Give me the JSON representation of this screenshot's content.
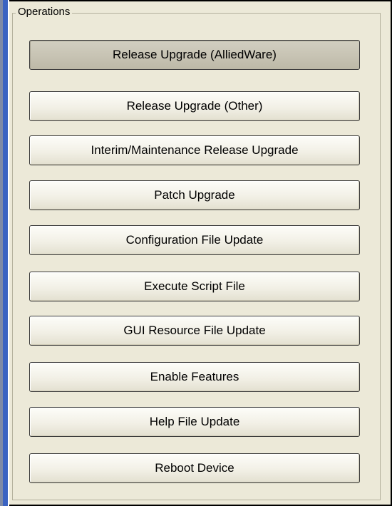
{
  "operations": {
    "group_title": "Operations",
    "buttons": [
      {
        "label": "Release Upgrade (AlliedWare)",
        "active": true
      },
      {
        "label": "Release Upgrade (Other)",
        "active": false
      },
      {
        "label": "Interim/Maintenance Release Upgrade",
        "active": false
      },
      {
        "label": "Patch Upgrade",
        "active": false
      },
      {
        "label": "Configuration File Update",
        "active": false
      },
      {
        "label": "Execute Script File",
        "active": false
      },
      {
        "label": "GUI Resource File Update",
        "active": false
      },
      {
        "label": "Enable Features",
        "active": false
      },
      {
        "label": "Help File Update",
        "active": false
      },
      {
        "label": "Reboot Device",
        "active": false
      }
    ]
  },
  "colors": {
    "panel_background": "#ece9d8",
    "accent_blue": "#3a63c2",
    "button_border": "#3b3b3b"
  }
}
